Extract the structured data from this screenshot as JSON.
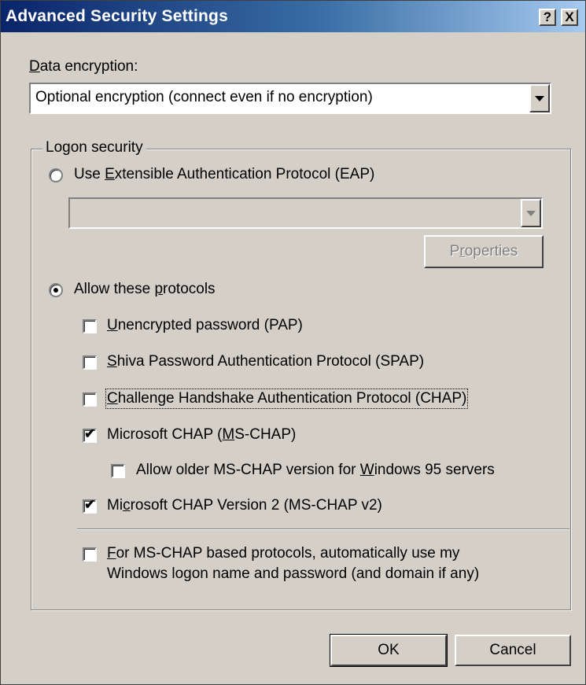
{
  "window": {
    "title": "Advanced Security Settings"
  },
  "titlebar_buttons": {
    "help": "?",
    "close": "X"
  },
  "data_encryption": {
    "label_pre": "",
    "label_u": "D",
    "label_post": "ata encryption:",
    "value": "Optional encryption (connect even if no encryption)"
  },
  "logon_security": {
    "legend": "Logon security",
    "eap": {
      "pre": "Use ",
      "u": "E",
      "post": "xtensible Authentication Protocol (EAP)",
      "selected": false
    },
    "eap_combo": {
      "value": ""
    },
    "properties": {
      "pre": "P",
      "u": "r",
      "post": "operties"
    },
    "allow": {
      "pre": "Allow these ",
      "u": "p",
      "post": "rotocols",
      "selected": true
    },
    "protocols": [
      {
        "pre": "",
        "u": "U",
        "post": "nencrypted password (PAP)",
        "checked": false
      },
      {
        "pre": "",
        "u": "S",
        "post": "hiva Password Authentication Protocol (SPAP)",
        "checked": false
      },
      {
        "pre": "",
        "u": "C",
        "post": "hallenge Handshake Authentication Protocol (CHAP)",
        "checked": false
      },
      {
        "pre": "Microsoft CHAP (",
        "u": "M",
        "post": "S-CHAP)",
        "checked": true
      },
      {
        "pre": "Allow older MS-CHAP version for ",
        "u": "W",
        "post": "indows 95 servers",
        "checked": false
      },
      {
        "pre": "Mi",
        "u": "c",
        "post": "rosoft CHAP Version 2 (MS-CHAP v2)",
        "checked": true
      }
    ],
    "auto_logon": {
      "line1_pre": "",
      "line1_u": "F",
      "line1_post": "or MS-CHAP based protocols, automatically use my",
      "line2": "Windows logon name and password (and domain if any)",
      "checked": false
    }
  },
  "buttons": {
    "ok": "OK",
    "cancel": "Cancel"
  },
  "glyphs": {
    "check": "✔"
  }
}
